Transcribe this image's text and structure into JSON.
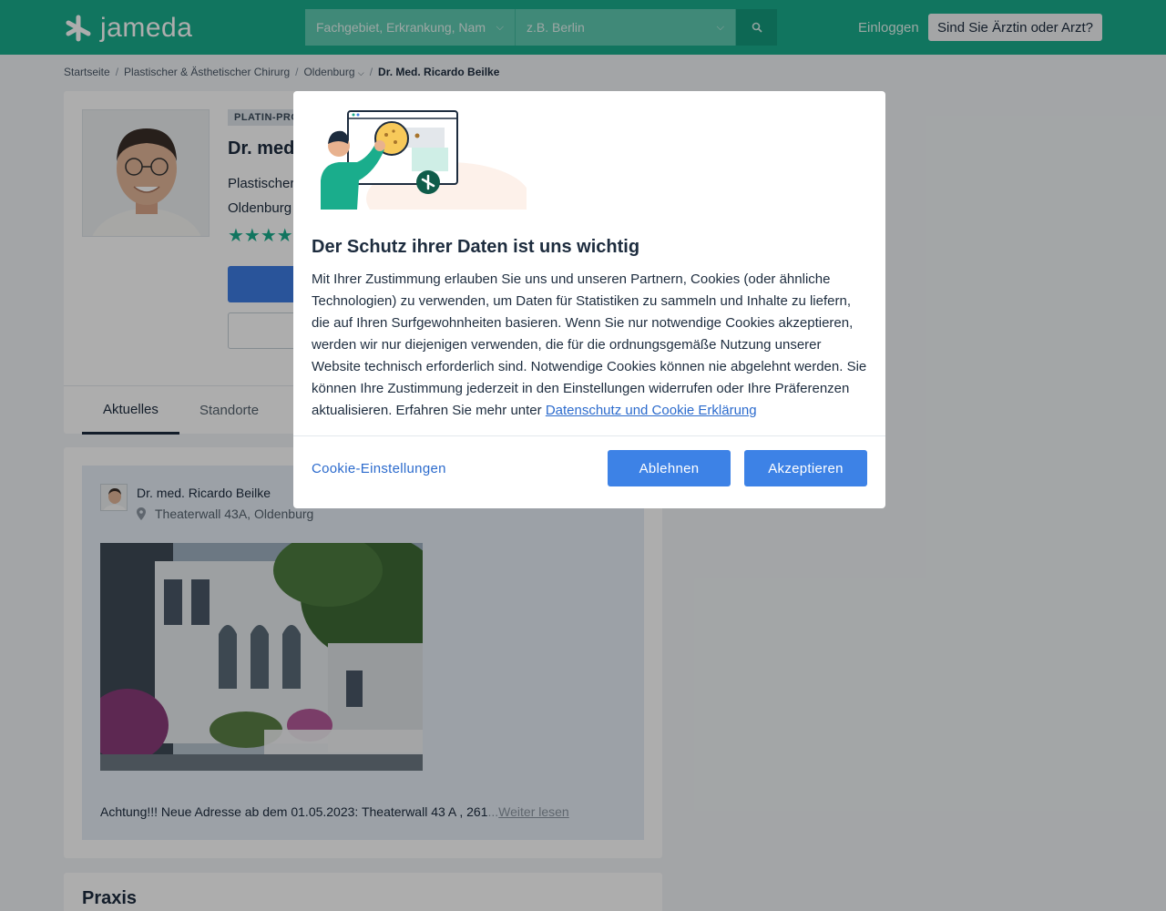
{
  "header": {
    "logo_text": "jameda",
    "search_specialty_placeholder": "Fachgebiet, Erkrankung, Nam",
    "search_location_placeholder": "z.B. Berlin",
    "login_label": "Einloggen",
    "doctor_button_label": "Sind Sie Ärztin oder Arzt?"
  },
  "breadcrumb": {
    "items": [
      "Startseite",
      "Plastischer & Ästhetischer Chirurg",
      "Oldenburg",
      "Dr. Med. Ricardo Beilke"
    ]
  },
  "profile": {
    "badge": "PLATIN-PRO",
    "name_partial": "Dr. med",
    "specialty_partial": "Plastischer",
    "city_partial": "Oldenburg",
    "stars": "★★★★"
  },
  "tabs": [
    "Aktuelles",
    "Standorte"
  ],
  "post": {
    "author": "Dr. med. Ricardo Beilke",
    "address": "Theaterwall 43A, Oldenburg",
    "text": "Achtung!!! Neue Adresse ab dem 01.05.2023: Theaterwall 43 A , 261",
    "ellipsis": "...",
    "more_label": "Weiter lesen"
  },
  "praxis": {
    "title": "Praxis"
  },
  "consent": {
    "title": "Der Schutz ihrer Daten ist uns wichtig",
    "body": "Mit Ihrer Zustimmung erlauben Sie uns und unseren Partnern, Cookies (oder ähnliche Technologien) zu verwenden, um Daten für Statistiken zu sammeln und Inhalte zu liefern, die auf Ihren Surfgewohnheiten basieren. Wenn Sie nur notwendige Cookies akzeptieren, werden wir nur diejenigen verwenden, die für die ordnungsgemäße Nutzung unserer Website technisch erforderlich sind. Notwendige Cookies können nie abgelehnt werden. Sie können Ihre Zustimmung jederzeit in den Einstellungen widerrufen oder Ihre Präferenzen aktualisieren. Erfahren Sie mehr unter",
    "link_label": "Datenschutz und Cookie Erklärung",
    "settings_label": "Cookie-Einstellungen",
    "reject_label": "Ablehnen",
    "accept_label": "Akzeptieren"
  },
  "colors": {
    "brand": "#1aad8c",
    "primary_button": "#3d82e6",
    "link": "#2c6bcd"
  },
  "icons": [
    "jameda-logo-icon",
    "chevron-down-icon",
    "search-icon",
    "location-pin-icon",
    "star-icon",
    "cookie-illustration"
  ]
}
